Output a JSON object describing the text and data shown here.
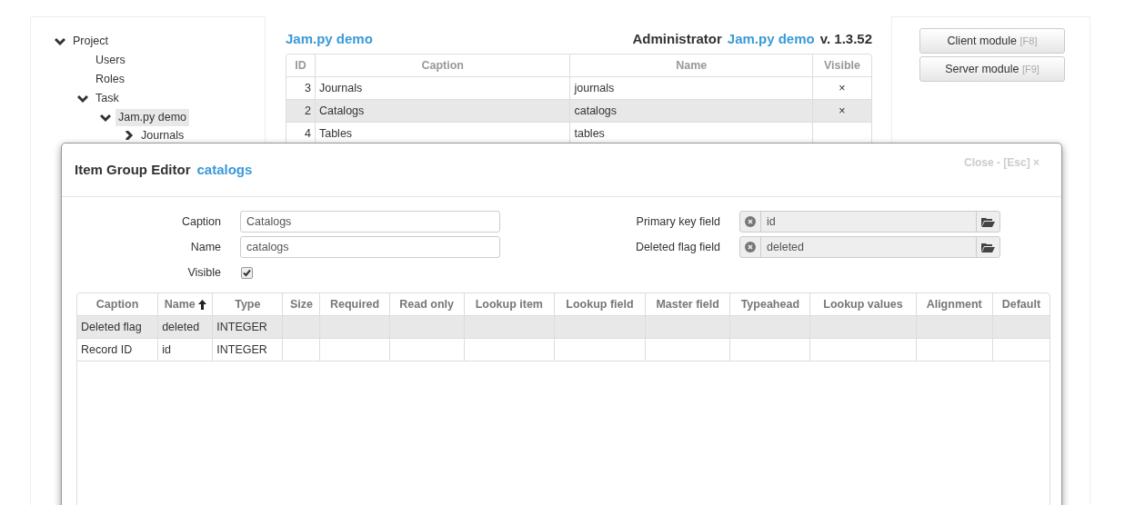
{
  "tree": [
    {
      "label": "Project",
      "expanded": true,
      "selected": false,
      "children": [
        {
          "label": "Users",
          "selected": false
        },
        {
          "label": "Roles",
          "selected": false
        },
        {
          "label": "Task",
          "expanded": true,
          "selected": false,
          "children": [
            {
              "label": "Jam.py demo",
              "expanded": true,
              "selected": true,
              "children": [
                {
                  "label": "Journals",
                  "expanded": false,
                  "selected": false
                }
              ]
            }
          ]
        }
      ]
    }
  ],
  "header": {
    "project_link": "Jam.py demo",
    "user": "Administrator",
    "app_link": "Jam.py demo",
    "version": "v. 1.3.52"
  },
  "items_table": {
    "columns": [
      "ID",
      "Caption",
      "Name",
      "Visible"
    ],
    "rows": [
      {
        "id": "3",
        "caption": "Journals",
        "name": "journals",
        "visible": "×",
        "selected": false
      },
      {
        "id": "2",
        "caption": "Catalogs",
        "name": "catalogs",
        "visible": "×",
        "selected": true
      },
      {
        "id": "4",
        "caption": "Tables",
        "name": "tables",
        "visible": "",
        "selected": false
      }
    ]
  },
  "module_buttons": [
    {
      "label": "Client module",
      "shortcut": "[F8]"
    },
    {
      "label": "Server module",
      "shortcut": "[F9]"
    }
  ],
  "dialog": {
    "title": "Item Group Editor",
    "subject": "catalogs",
    "close": "Close - [Esc] ×",
    "fields": [
      {
        "label": "Caption",
        "value": "Catalogs"
      },
      {
        "label": "Name",
        "value": "catalogs"
      }
    ],
    "visible": {
      "label": "Visible",
      "checked": true
    },
    "lookup_fields": [
      {
        "label": "Primary key field",
        "value": "id"
      },
      {
        "label": "Deleted flag field",
        "value": "deleted"
      }
    ],
    "grid": {
      "columns": [
        {
          "label": "Caption",
          "sorted": false
        },
        {
          "label": "Name",
          "sorted": true
        },
        {
          "label": "Type",
          "sorted": false
        },
        {
          "label": "Size",
          "sorted": false
        },
        {
          "label": "Required",
          "sorted": false
        },
        {
          "label": "Read only",
          "sorted": false
        },
        {
          "label": "Lookup item",
          "sorted": false
        },
        {
          "label": "Lookup field",
          "sorted": false
        },
        {
          "label": "Master field",
          "sorted": false
        },
        {
          "label": "Typeahead",
          "sorted": false
        },
        {
          "label": "Lookup values",
          "sorted": false
        },
        {
          "label": "Alignment",
          "sorted": false
        },
        {
          "label": "Default",
          "sorted": false
        }
      ],
      "rows": [
        {
          "cells": [
            "Deleted flag",
            "deleted",
            "INTEGER",
            "",
            "",
            "",
            "",
            "",
            "",
            "",
            "",
            "",
            ""
          ],
          "selected": true
        },
        {
          "cells": [
            "Record ID",
            "id",
            "INTEGER",
            "",
            "",
            "",
            "",
            "",
            "",
            "",
            "",
            "",
            ""
          ],
          "selected": false
        }
      ]
    }
  }
}
